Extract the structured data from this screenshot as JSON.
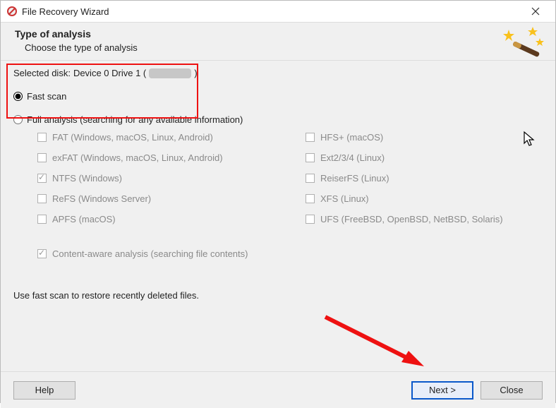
{
  "titlebar": {
    "title": "File Recovery Wizard"
  },
  "header": {
    "title": "Type of analysis",
    "subtitle": "Choose the type of analysis"
  },
  "selected_disk": {
    "prefix": "Selected disk: ",
    "device": "Device 0 Drive 1 (",
    "suffix": ")"
  },
  "radios": {
    "fast": "Fast scan",
    "full": "Full analysis (searching for any available information)"
  },
  "filesystems": {
    "left": [
      "FAT (Windows, macOS, Linux, Android)",
      "exFAT (Windows, macOS, Linux, Android)",
      "NTFS (Windows)",
      "ReFS (Windows Server)",
      "APFS (macOS)"
    ],
    "right": [
      "HFS+ (macOS)",
      "Ext2/3/4 (Linux)",
      "ReiserFS (Linux)",
      "XFS (Linux)",
      "UFS (FreeBSD, OpenBSD, NetBSD, Solaris)"
    ],
    "checked_left_idx": 2
  },
  "content_aware": "Content-aware analysis (searching file contents)",
  "hint": "Use fast scan to restore recently deleted files.",
  "buttons": {
    "help": "Help",
    "next": "Next >",
    "close": "Close"
  }
}
